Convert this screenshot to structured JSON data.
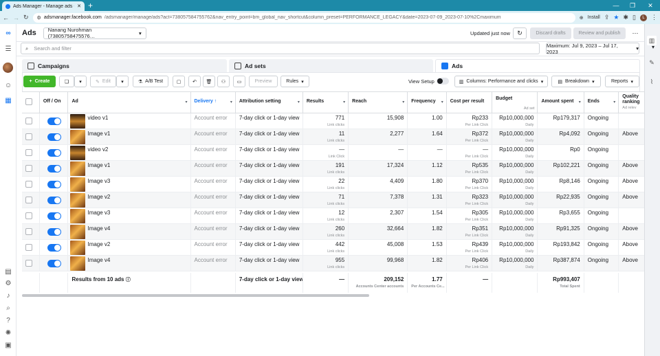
{
  "browser": {
    "tab_title": "Ads Manager - Manage ads - Ad",
    "url_domain": "adsmanager.facebook.com",
    "url_rest": "/adsmanager/manage/ads?act=738057584755762&nav_entry_point=bm_global_nav_shortcut&column_preset=PERFORMANCE_LEGACY&date=2023-07-09_2023-07-10%2Cmaximum",
    "install_label": "Install",
    "profile_initial": "L"
  },
  "header": {
    "title": "Ads",
    "account": "Nanang Nurohman (73805758475576…",
    "updated": "Updated just now",
    "discard": "Discard drafts",
    "review": "Review and publish"
  },
  "search": {
    "placeholder": "Search and filter",
    "date_range": "Maximum: Jul 9, 2023 – Jul 17, 2023"
  },
  "level_tabs": {
    "campaigns": "Campaigns",
    "adsets": "Ad sets",
    "ads": "Ads"
  },
  "toolbar": {
    "create": "Create",
    "edit": "Edit",
    "ab_test": "A/B Test",
    "preview": "Preview",
    "rules": "Rules",
    "view_setup": "View Setup",
    "columns": "Columns: Performance and clicks",
    "breakdown": "Breakdown",
    "reports": "Reports"
  },
  "columns": {
    "offon": "Off / On",
    "ad": "Ad",
    "delivery": "Delivery ↑",
    "attribution": "Attribution setting",
    "results": "Results",
    "reach": "Reach",
    "frequency": "Frequency",
    "cpr": "Cost per result",
    "budget": "Budget",
    "budget_sub": "Ad set",
    "amount": "Amount spent",
    "ends": "Ends",
    "quality": "Quality ranking",
    "quality_sub": "Ad relev"
  },
  "rows": [
    {
      "ad": "video v1",
      "delivery": "Account error",
      "attribution": "7-day click or 1-day view",
      "results": "771",
      "results_sub": "Link clicks",
      "reach": "15,908",
      "frequency": "1.00",
      "cpr": "Rp233",
      "cpr_sub": "Per Link Click",
      "budget": "Rp10,000,000",
      "budget_sub": "Daily",
      "amount": "Rp179,317",
      "ends": "Ongoing",
      "quality": ""
    },
    {
      "ad": "Image v1",
      "delivery": "Account error",
      "attribution": "7-day click or 1-day view",
      "results": "11",
      "results_sub": "Link clicks",
      "reach": "2,277",
      "frequency": "1.64",
      "cpr": "Rp372",
      "cpr_sub": "Per Link Click",
      "budget": "Rp10,000,000",
      "budget_sub": "Daily",
      "amount": "Rp4,092",
      "ends": "Ongoing",
      "quality": "Above"
    },
    {
      "ad": "video v2",
      "delivery": "Account error",
      "attribution": "7-day click or 1-day view",
      "results": "—",
      "results_sub": "Link Click",
      "reach": "—",
      "frequency": "—",
      "cpr": "—",
      "cpr_sub": "Per Link Click",
      "budget": "Rp10,000,000",
      "budget_sub": "Daily",
      "amount": "Rp0",
      "ends": "Ongoing",
      "quality": ""
    },
    {
      "ad": "Image v1",
      "delivery": "Account error",
      "attribution": "7-day click or 1-day view",
      "results": "191",
      "results_sub": "Link clicks",
      "reach": "17,324",
      "frequency": "1.12",
      "cpr": "Rp535",
      "cpr_sub": "Per Link Click",
      "budget": "Rp10,000,000",
      "budget_sub": "Daily",
      "amount": "Rp102,221",
      "ends": "Ongoing",
      "quality": "Above"
    },
    {
      "ad": "Image v3",
      "delivery": "Account error",
      "attribution": "7-day click or 1-day view",
      "results": "22",
      "results_sub": "Link clicks",
      "reach": "4,409",
      "frequency": "1.80",
      "cpr": "Rp370",
      "cpr_sub": "Per Link Click",
      "budget": "Rp10,000,000",
      "budget_sub": "Daily",
      "amount": "Rp8,146",
      "ends": "Ongoing",
      "quality": "Above"
    },
    {
      "ad": "Image v2",
      "delivery": "Account error",
      "attribution": "7-day click or 1-day view",
      "results": "71",
      "results_sub": "Link clicks",
      "reach": "7,378",
      "frequency": "1.31",
      "cpr": "Rp323",
      "cpr_sub": "Per Link Click",
      "budget": "Rp10,000,000",
      "budget_sub": "Daily",
      "amount": "Rp22,935",
      "ends": "Ongoing",
      "quality": "Above"
    },
    {
      "ad": "Image v3",
      "delivery": "Account error",
      "attribution": "7-day click or 1-day view",
      "results": "12",
      "results_sub": "Link clicks",
      "reach": "2,307",
      "frequency": "1.54",
      "cpr": "Rp305",
      "cpr_sub": "Per Link Click",
      "budget": "Rp10,000,000",
      "budget_sub": "Daily",
      "amount": "Rp3,655",
      "ends": "Ongoing",
      "quality": ""
    },
    {
      "ad": "Image v4",
      "delivery": "Account error",
      "attribution": "7-day click or 1-day view",
      "results": "260",
      "results_sub": "Link clicks",
      "reach": "32,664",
      "frequency": "1.82",
      "cpr": "Rp351",
      "cpr_sub": "Per Link Click",
      "budget": "Rp10,000,000",
      "budget_sub": "Daily",
      "amount": "Rp91,325",
      "ends": "Ongoing",
      "quality": "Above"
    },
    {
      "ad": "Image v2",
      "delivery": "Account error",
      "attribution": "7-day click or 1-day view",
      "results": "442",
      "results_sub": "Link clicks",
      "reach": "45,008",
      "frequency": "1.53",
      "cpr": "Rp439",
      "cpr_sub": "Per Link Click",
      "budget": "Rp10,000,000",
      "budget_sub": "Daily",
      "amount": "Rp193,842",
      "ends": "Ongoing",
      "quality": "Above"
    },
    {
      "ad": "Image v4",
      "delivery": "Account error",
      "attribution": "7-day click or 1-day view",
      "results": "955",
      "results_sub": "Link clicks",
      "reach": "99,968",
      "frequency": "1.82",
      "cpr": "Rp406",
      "cpr_sub": "Per Link Click",
      "budget": "Rp10,000,000",
      "budget_sub": "Daily",
      "amount": "Rp387,874",
      "ends": "Ongoing",
      "quality": "Above"
    }
  ],
  "footer": {
    "label": "Results from 10 ads",
    "attribution": "7-day click or 1-day view",
    "results": "—",
    "reach": "209,152",
    "reach_sub": "Accounts Center accounts",
    "frequency": "1.77",
    "frequency_sub": "Per Accounts Ce...",
    "cpr": "—",
    "amount": "Rp993,407",
    "amount_sub": "Total Spent"
  },
  "colors": {
    "accent": "#1877f2",
    "create_green": "#42b72a",
    "chrome_teal": "#1d8aa8"
  }
}
